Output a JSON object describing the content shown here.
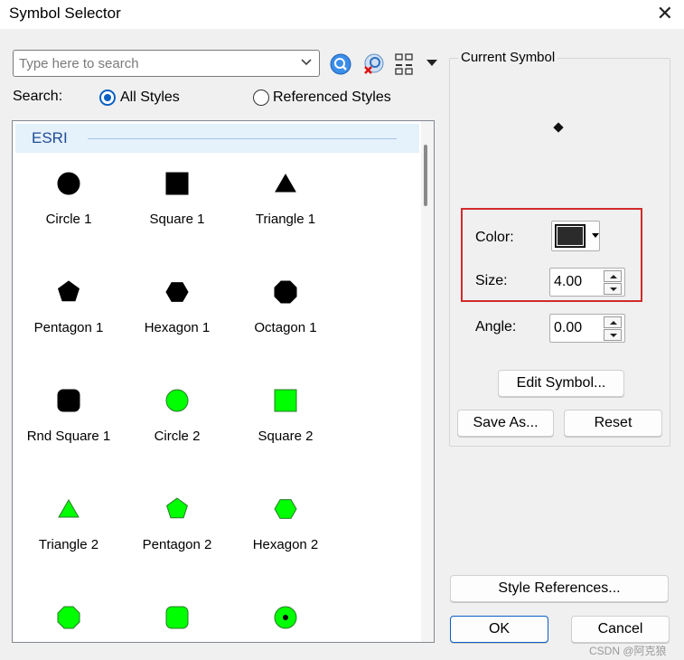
{
  "window": {
    "title": "Symbol Selector",
    "close_glyph": "✕"
  },
  "search": {
    "placeholder": "Type here to search",
    "value": ""
  },
  "toolbar_icons": [
    "search-icon",
    "clear-search-icon",
    "view-options-icon",
    "dropdown-arrow-icon"
  ],
  "search_scope": {
    "label": "Search:",
    "options": [
      {
        "label": "All Styles",
        "selected": true
      },
      {
        "label": "Referenced Styles",
        "selected": false
      }
    ]
  },
  "symbol_list": {
    "group": "ESRI",
    "items": [
      {
        "label": "Circle 1",
        "shape": "circle",
        "color": "#000000"
      },
      {
        "label": "Square 1",
        "shape": "square",
        "color": "#000000"
      },
      {
        "label": "Triangle 1",
        "shape": "triangle",
        "color": "#000000"
      },
      {
        "label": "Pentagon 1",
        "shape": "pentagon",
        "color": "#000000"
      },
      {
        "label": "Hexagon 1",
        "shape": "hexagon",
        "color": "#000000"
      },
      {
        "label": "Octagon 1",
        "shape": "octagon",
        "color": "#000000"
      },
      {
        "label": "Rnd Square 1",
        "shape": "rounded-square",
        "color": "#000000"
      },
      {
        "label": "Circle 2",
        "shape": "circle",
        "color": "#00ff00"
      },
      {
        "label": "Square 2",
        "shape": "square",
        "color": "#00ff00"
      },
      {
        "label": "Triangle 2",
        "shape": "triangle",
        "color": "#00ff00"
      },
      {
        "label": "Pentagon 2",
        "shape": "pentagon",
        "color": "#00ff00"
      },
      {
        "label": "Hexagon 2",
        "shape": "hexagon",
        "color": "#00ff00"
      },
      {
        "label": "",
        "shape": "octagon",
        "color": "#00ff00"
      },
      {
        "label": "",
        "shape": "rounded-square",
        "color": "#00ff00"
      },
      {
        "label": "",
        "shape": "circle-dot",
        "color": "#00ff00"
      }
    ]
  },
  "current_symbol": {
    "title": "Current Symbol",
    "color_label": "Color:",
    "color_value": "#2b2b2b",
    "size_label": "Size:",
    "size_value": "4.00",
    "angle_label": "Angle:",
    "angle_value": "0.00"
  },
  "buttons": {
    "edit_symbol": "Edit Symbol...",
    "save_as": "Save As...",
    "reset": "Reset",
    "style_references": "Style References...",
    "ok": "OK",
    "cancel": "Cancel"
  },
  "highlight_color": "#d22b2b",
  "accent_color": "#0a5fc4",
  "watermark": "CSDN @阿克狼"
}
